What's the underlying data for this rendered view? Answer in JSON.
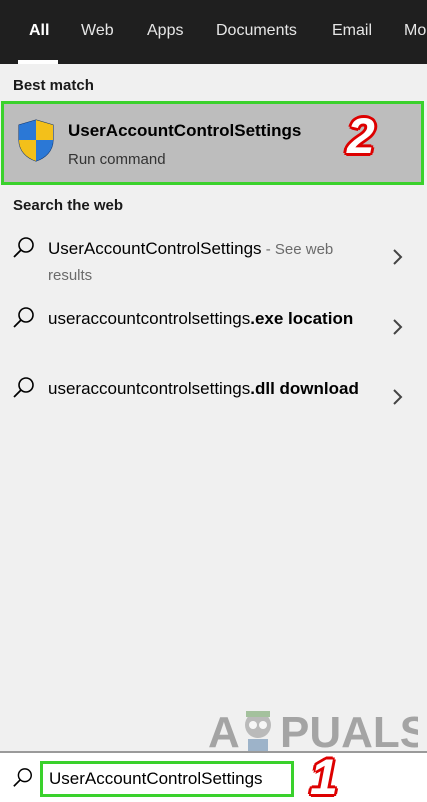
{
  "tabs": [
    {
      "label": "All",
      "active": true
    },
    {
      "label": "Web",
      "active": false
    },
    {
      "label": "Apps",
      "active": false
    },
    {
      "label": "Documents",
      "active": false
    },
    {
      "label": "Email",
      "active": false
    },
    {
      "label": "Mo",
      "active": false
    }
  ],
  "best_match": {
    "heading": "Best match",
    "title": "UserAccountControlSettings",
    "subtitle": "Run command",
    "icon": "uac-shield-icon",
    "step_marker": "2"
  },
  "web": {
    "heading": "Search the web",
    "results": [
      {
        "prefix": "UserAccountControlSettings",
        "suffix": " - See web results",
        "bold_part": ""
      },
      {
        "prefix": "useraccountcontrolsettings",
        "bold_part": ".exe location",
        "suffix": ""
      },
      {
        "prefix": "useraccountcontrolsettings",
        "bold_part": ".dll download",
        "suffix": ""
      }
    ]
  },
  "watermark": {
    "text": "APPUALS"
  },
  "search": {
    "value": "UserAccountControlSettings",
    "step_marker": "1"
  },
  "colors": {
    "tabbar_bg": "#1f1f1f",
    "highlight_border": "#3ad12c",
    "best_bg": "#bdbdbd",
    "marker_outline": "#dd0000"
  }
}
